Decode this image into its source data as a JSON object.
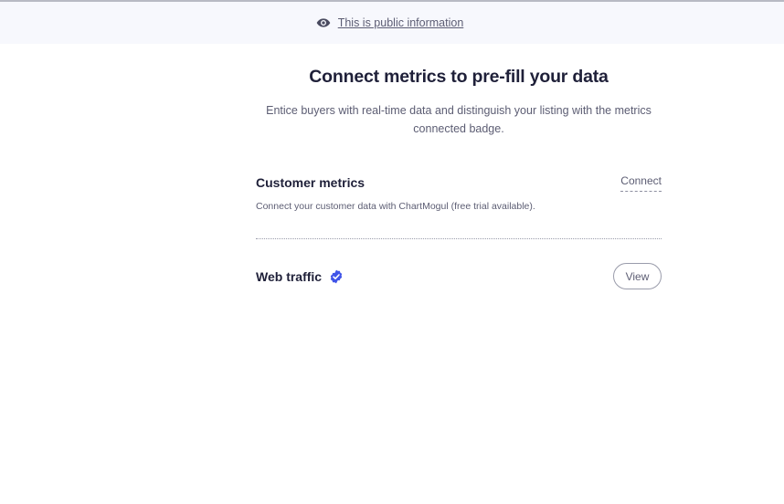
{
  "info_bar": {
    "icon": "eye-icon",
    "text": "This is public information"
  },
  "main": {
    "title": "Connect metrics to pre-fill your data",
    "subtitle": "Entice buyers with real-time data and distinguish your listing with the metrics connected badge."
  },
  "metrics": [
    {
      "title": "Customer metrics",
      "description": "Connect your customer data with ChartMogul (free trial available).",
      "action_label": "Connect"
    },
    {
      "title": "Web traffic",
      "verified_icon": "check-badge-icon",
      "action_label": "View"
    }
  ],
  "colors": {
    "heading": "#1f2039",
    "muted": "#5c5d73",
    "info_bar_bg": "#f7f8fd",
    "verified": "#4054e8"
  }
}
